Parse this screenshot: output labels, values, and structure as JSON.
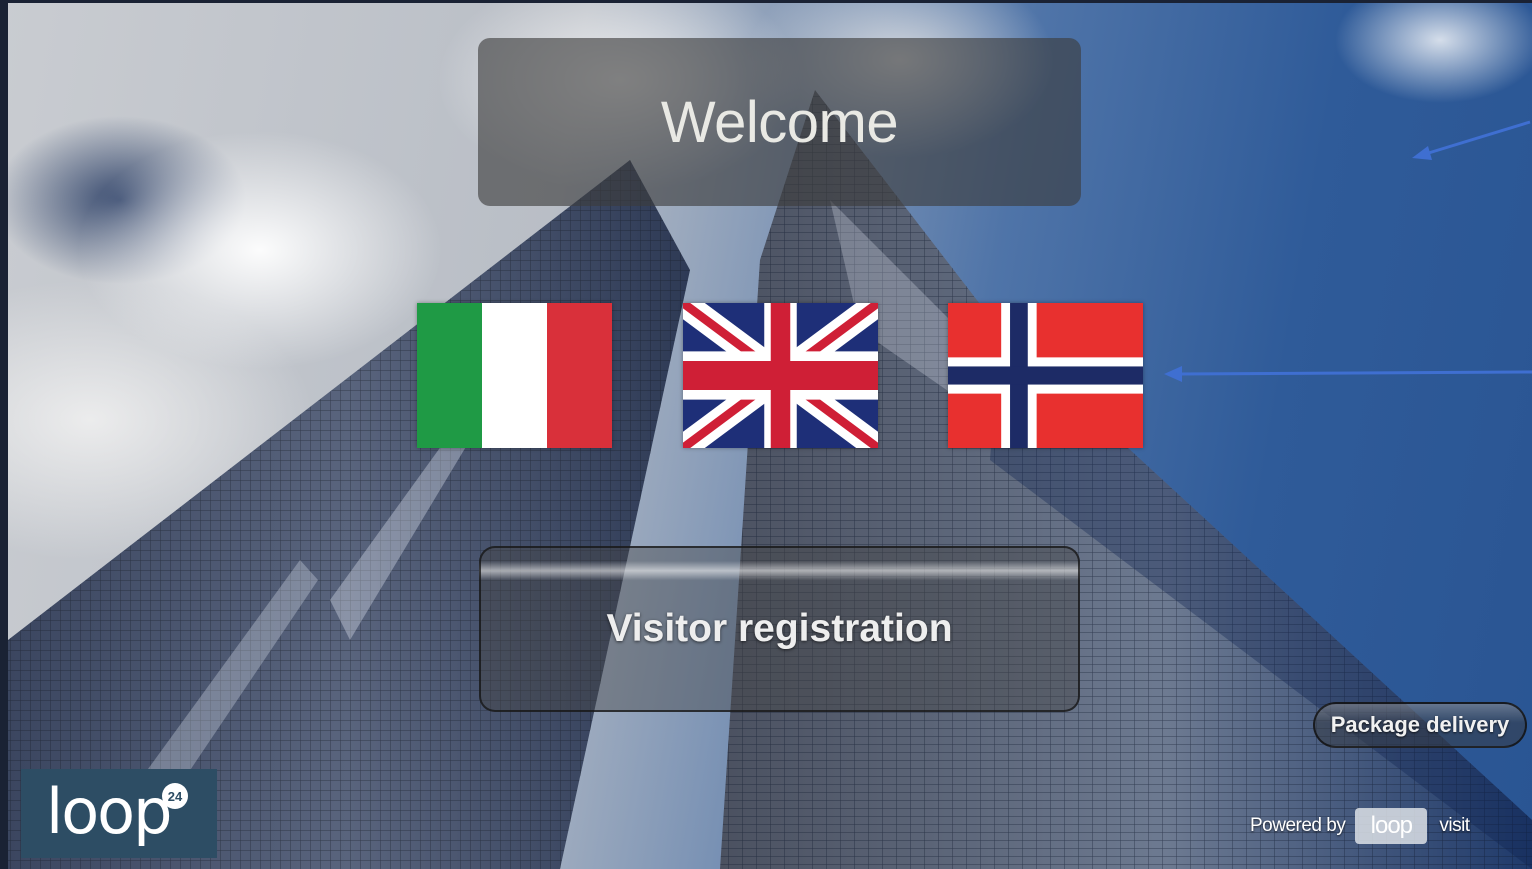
{
  "header": {
    "welcome_text": "Welcome"
  },
  "languages": [
    {
      "name": "Italian",
      "icon": "flag-italy-icon"
    },
    {
      "name": "English",
      "icon": "flag-uk-icon"
    },
    {
      "name": "Norwegian",
      "icon": "flag-norway-icon"
    }
  ],
  "main": {
    "visitor_button_label": "Visitor registration"
  },
  "footer": {
    "package_button_label": "Package delivery",
    "logo_text": "loop",
    "logo_badge": "24",
    "powered_by": "Powered by",
    "powered_logo_text": "loop",
    "visit": "visit"
  },
  "colors": {
    "logo_bg": "#2d4d64",
    "annotation_arrow": "#3f6fd1"
  }
}
